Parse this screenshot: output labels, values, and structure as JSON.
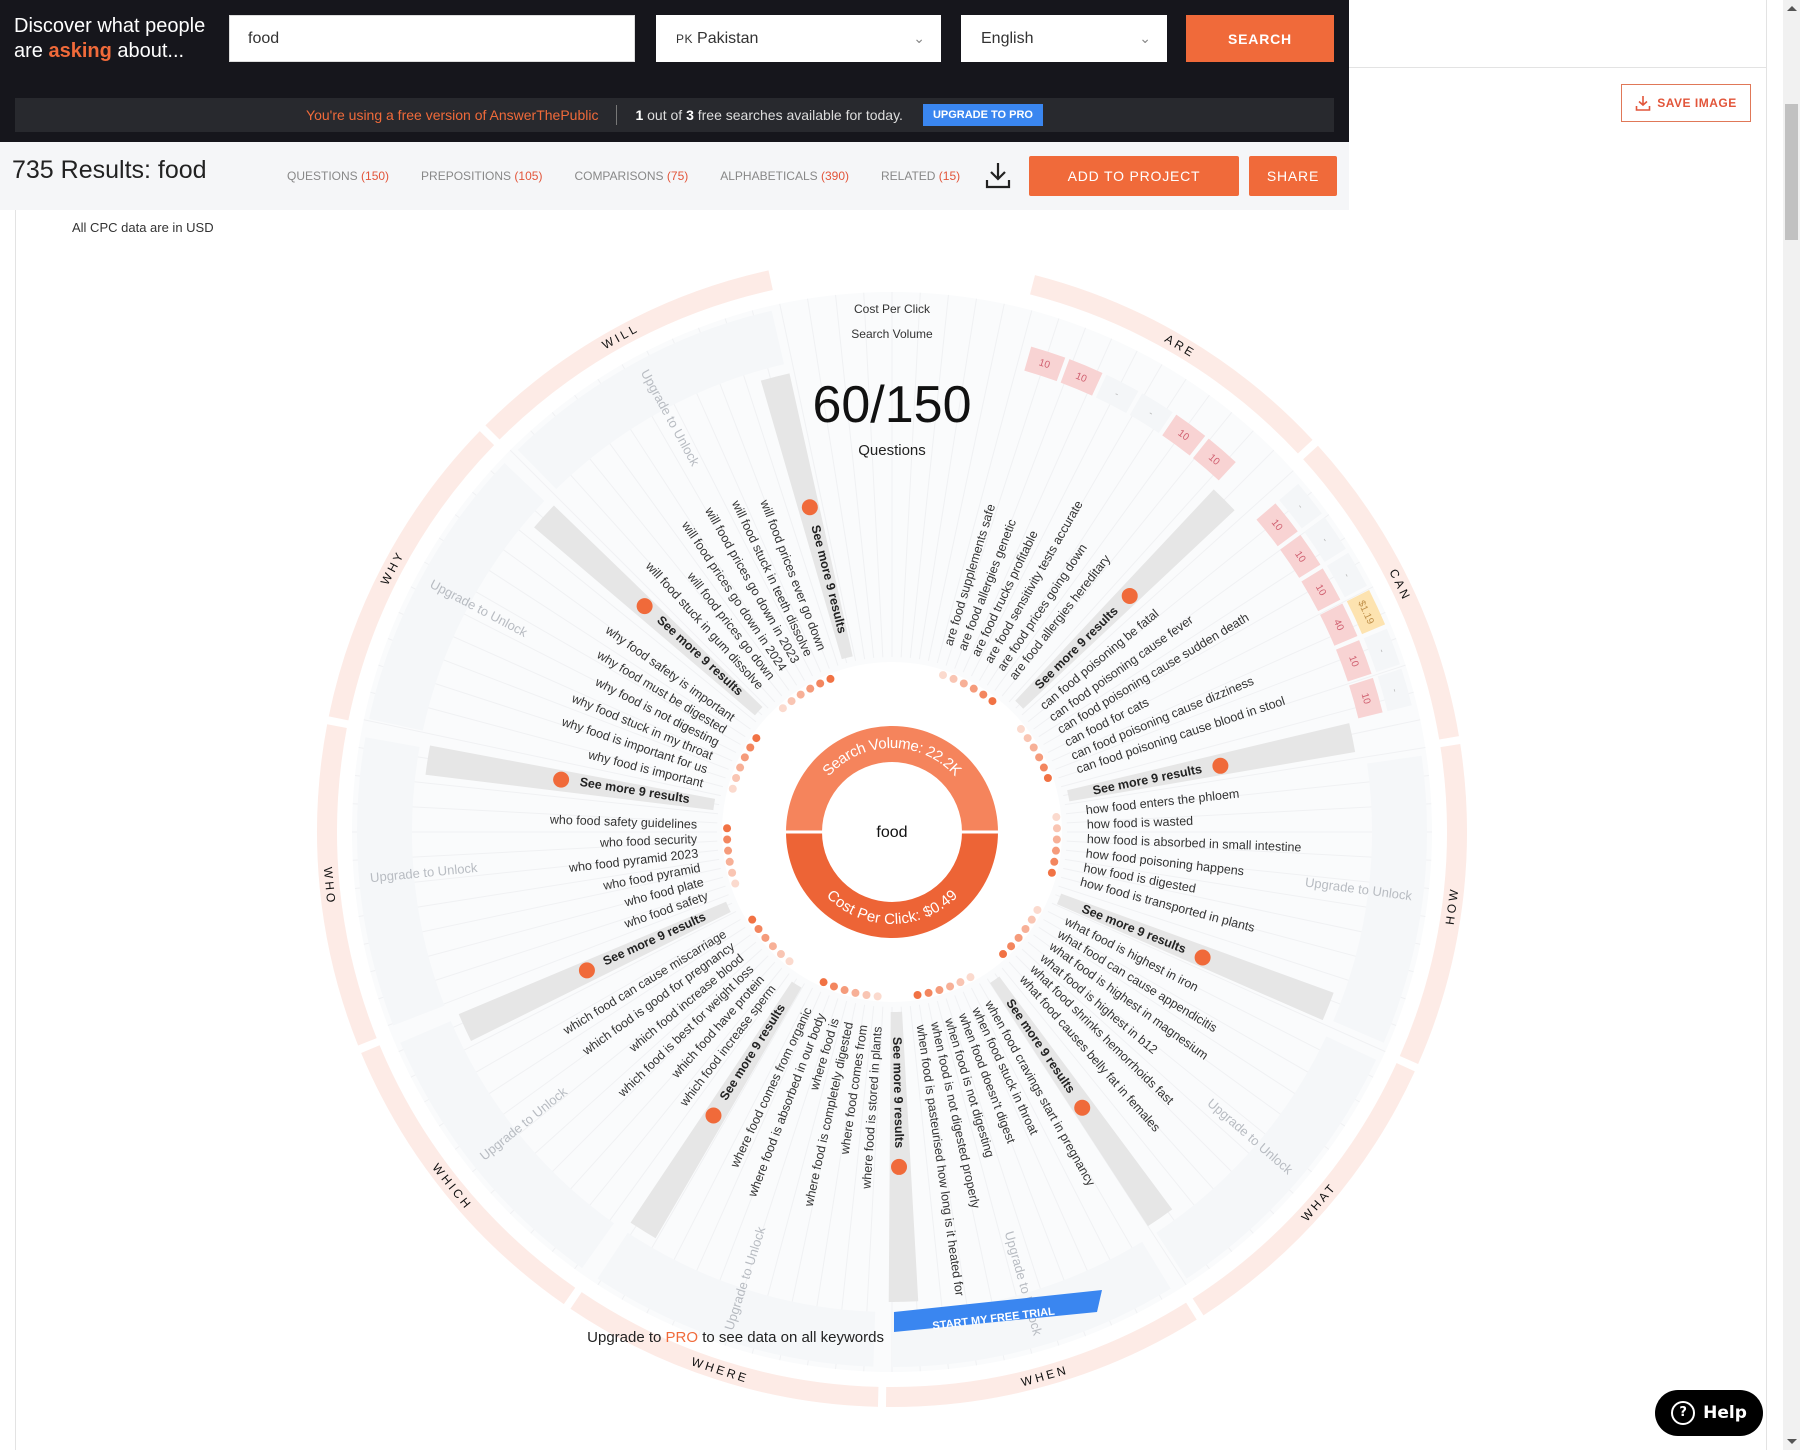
{
  "header": {
    "tagline_line1": "Discover what people",
    "tagline_pre": "are ",
    "tagline_accent": "asking",
    "tagline_post": " about...",
    "search_value": "food",
    "search_placeholder": "",
    "country_code": "PK",
    "country": "Pakistan",
    "language": "English",
    "search_button": "SEARCH",
    "notice_free": "You're using a free version of AnswerThePublic",
    "notice_used": "1",
    "notice_mid": " out of ",
    "notice_total": "3",
    "notice_tail": " free searches available for today.",
    "upgrade_button": "UPGRADE TO PRO"
  },
  "results": {
    "title": "735 Results: food",
    "tabs": [
      {
        "label": "QUESTIONS",
        "count": "(150)"
      },
      {
        "label": "PREPOSITIONS",
        "count": "(105)"
      },
      {
        "label": "COMPARISONS",
        "count": "(75)"
      },
      {
        "label": "ALPHABETICALS",
        "count": "(390)"
      },
      {
        "label": "RELATED",
        "count": "(15)"
      }
    ],
    "add_to_project": "ADD TO PROJECT",
    "share": "SHARE",
    "save_image": "SAVE IMAGE",
    "cpc_note": "All CPC data are in USD"
  },
  "wheel": {
    "legend_cpc": "Cost Per Click",
    "legend_volume": "Search Volume",
    "count_display": "60/150",
    "count_label": "Questions",
    "keyword": "food",
    "search_volume_label": "Search Volume: 22.2K",
    "cpc_label": "Cost Per Click: $0.49",
    "see_more": "See more 9 results",
    "upgrade_to_unlock": "Upgrade to Unlock",
    "upgrade_pro_pre": "Upgrade to ",
    "upgrade_pro_accent": "PRO",
    "upgrade_pro_post": " to see data on all keywords",
    "free_trial": "START MY FREE TRIAL",
    "colors": {
      "accent": "#f06a3a",
      "ring": "#fdebe6",
      "blue": "#3a86f0",
      "volume_cell": "#f8d3d3",
      "cpc_cell": "#fde3b0"
    },
    "categories": [
      {
        "name": "ARE",
        "items": [
          "are food supplements safe",
          "are food allergies genetic",
          "are food trucks profitable",
          "are food sensitivity tests accurate",
          "are food prices going down",
          "are food allergies hereditary"
        ],
        "volumes": [
          "10",
          "10",
          "-",
          "-",
          "10",
          "10"
        ],
        "cpc": []
      },
      {
        "name": "CAN",
        "items": [
          "can food poisoning be fatal",
          "can food poisoning cause fever",
          "can food poisoning cause sudden death",
          "can food for cats",
          "can food poisoning cause dizziness",
          "can food poisoning cause blood in stool"
        ],
        "volumes": [
          "10",
          "10",
          "10",
          "40",
          "10",
          "10"
        ],
        "cpc": [
          "-",
          "-",
          "-",
          "$1.19",
          "-",
          "-"
        ]
      },
      {
        "name": "HOW",
        "items": [
          "how food enters the phloem",
          "how food is wasted",
          "how food is absorbed in small intestine",
          "how food poisoning happens",
          "how food is digested",
          "how food is transported in plants"
        ]
      },
      {
        "name": "WHAT",
        "items": [
          "what food is highest in iron",
          "what food can cause appendicitis",
          "what food is highest in magnesium",
          "what food is highest in b12",
          "what food shrinks hemorrhoids fast",
          "what food causes belly fat in females"
        ]
      },
      {
        "name": "WHEN",
        "items": [
          "when food cravings start in pregnancy",
          "when food stuck in throat",
          "when food doesn't digest",
          "when food is not digesting",
          "when food is not digested properly",
          "when food is pasteurised how long is it heated for"
        ]
      },
      {
        "name": "WHERE",
        "items": [
          "where food is stored in plants",
          "where food comes from",
          "where food is completely digested",
          "where food is",
          "where food is absorbed in our body",
          "where food comes from organic"
        ]
      },
      {
        "name": "WHICH",
        "items": [
          "which food increase sperm",
          "which food have protein",
          "which food is best for weight loss",
          "which food increase blood",
          "which food is good for pregnancy",
          "which food can cause miscarriage"
        ]
      },
      {
        "name": "WHO",
        "items": [
          "who food safety",
          "who food plate",
          "who food pyramid",
          "who food pyramid 2023",
          "who food security",
          "who food safety guidelines"
        ]
      },
      {
        "name": "WHY",
        "items": [
          "why food is important",
          "why food is important for us",
          "why food stuck in my throat",
          "why food is not digesting",
          "why food must be digested",
          "why food safety is important"
        ]
      },
      {
        "name": "WILL",
        "items": [
          "will food stuck in gum dissolve",
          "will food prices go down",
          "will food prices go down in 2024",
          "will food prices go down in 2023",
          "will food stuck in teeth dissolve",
          "will food prices ever go down"
        ]
      }
    ]
  },
  "help": {
    "label": "Help"
  }
}
